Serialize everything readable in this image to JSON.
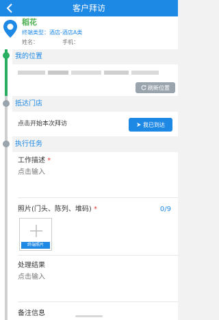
{
  "nav": {
    "title": "客户拜访"
  },
  "store": {
    "name": "稻花",
    "type_label": "终端类型：酒店-酒店A类",
    "contact_label": "姓名：",
    "phone_label": "手机："
  },
  "sections": {
    "location": {
      "title": "我的位置",
      "refresh_label": "刷新位置"
    },
    "arrive": {
      "title": "抵达门店",
      "prompt": "点击开始本次拜访",
      "button_label": "我已到达"
    },
    "task": {
      "title": "执行任务"
    }
  },
  "form": {
    "work_desc": {
      "label": "工作描述",
      "required": "*",
      "hint": "点击输入"
    },
    "photo": {
      "label": "照片(门头、陈列、堆码)",
      "required": "*",
      "count": "0/9",
      "tag": "终端照片"
    },
    "result": {
      "label": "处理结果",
      "hint": "点击输入"
    },
    "remark": {
      "label": "备注信息"
    }
  },
  "colors": {
    "primary": "#1e88e5",
    "green": "#27ae60",
    "red": "#e53935"
  }
}
